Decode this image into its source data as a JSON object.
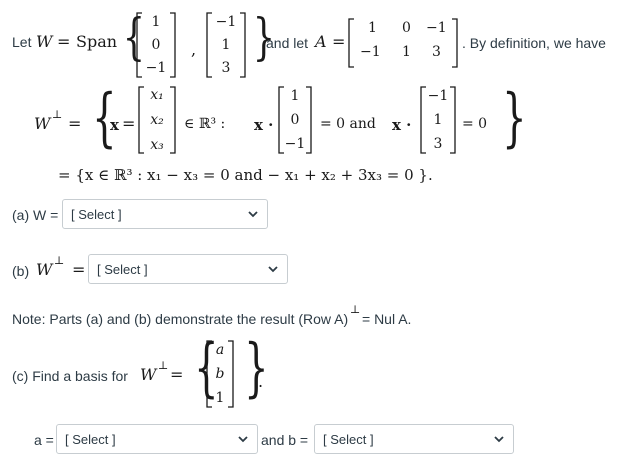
{
  "intro": {
    "let_w": "Let",
    "span_word": "Span",
    "and_let": "and let",
    "definition": ". By definition, we have",
    "vec1": [
      "1",
      "0",
      "−1"
    ],
    "vec2": [
      "−1",
      "1",
      "3"
    ],
    "matrix_row1": [
      "1",
      "0",
      "−1"
    ],
    "matrix_row2": [
      "−1",
      "1",
      "3"
    ]
  },
  "def": {
    "wperp": "W",
    "perp": "⊥",
    "x_vec": [
      "x₁",
      "x₂",
      "x₃"
    ],
    "in_r3": "∈ ℝ³  :",
    "dot_vec1": [
      "1",
      "0",
      "−1"
    ],
    "eq0_and": "= 0  and",
    "dot_vec2": [
      "−1",
      "1",
      "3"
    ],
    "eq0": "= 0",
    "line2": "= {x ∈ ℝ³ : x₁ − x₃ = 0  and  − x₁ + x₂ + 3x₃ = 0 }."
  },
  "part_a": {
    "label": "(a) W =",
    "select_value": "[ Select ]"
  },
  "part_b": {
    "label": "(b)",
    "select_value": "[ Select ]"
  },
  "note": "Note: Parts (a) and (b) demonstrate the result (Row A)",
  "note_tail": " = Nul A.",
  "part_c": {
    "label": "(c) Find a basis for",
    "basis_vec": [
      "a",
      "b",
      "1"
    ],
    "a_label": "a =",
    "a_select": "[ Select ]",
    "and_b": "and b =",
    "b_select": "[ Select ]"
  }
}
